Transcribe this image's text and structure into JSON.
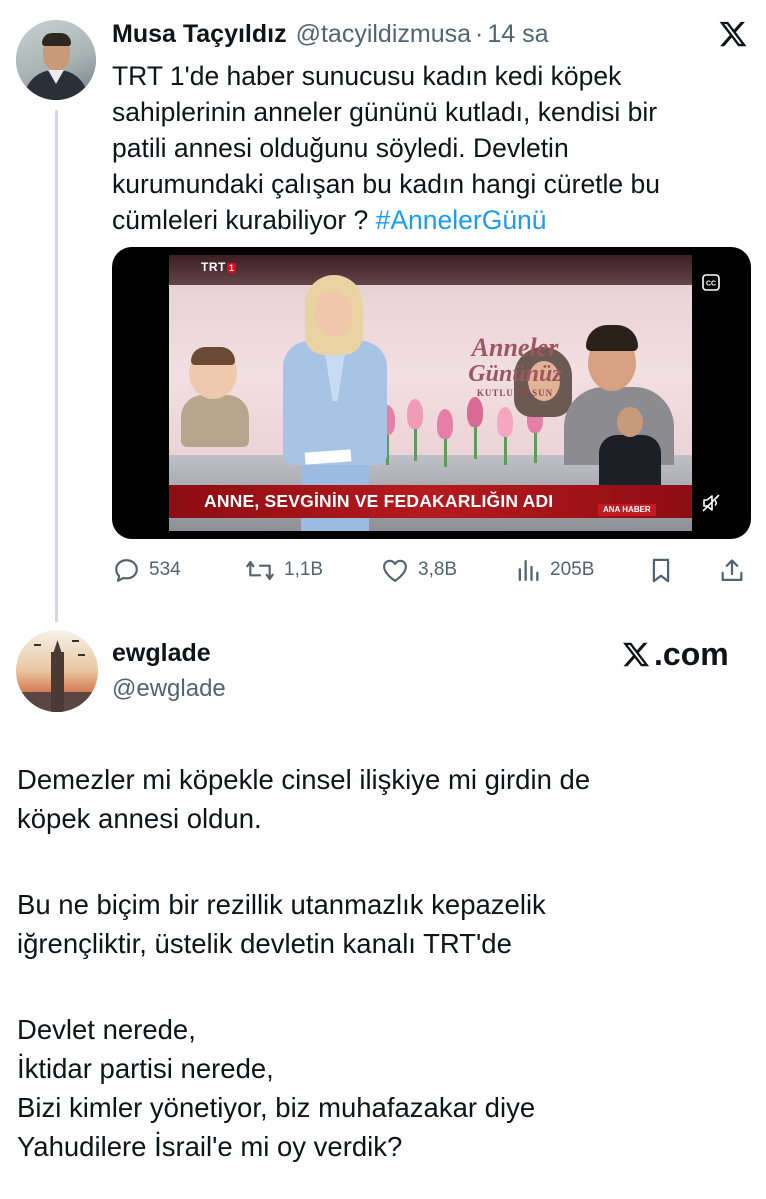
{
  "tweet": {
    "author_name": "Musa Taçyıldız",
    "author_handle": "@tacyildizmusa",
    "separator": "·",
    "time": "14 sa",
    "platform_icon": "x-logo-icon",
    "text_lines": [
      "TRT 1'de haber sunucusu kadın kedi köpek",
      "sahiplerinin anneler gününü kutladı, kendisi bir",
      "patili annesi olduğunu söyledi. Devletin",
      "kurumundaki  çalışan bu kadın hangi cüretle bu",
      "cümleleri kurabiliyor ? "
    ],
    "hashtag": "#AnnelerGünü",
    "hashtag_color": "#1d9bf0",
    "media": {
      "channel_logo": "TRT",
      "channel_number": "1",
      "banner_line1": "Anneler",
      "banner_line2": "Gününüz",
      "banner_line3": "KUTLU OLSUN",
      "lower_third": "ANNE, SEVGİNİN VE FEDAKARLIĞIN ADI",
      "program_tag": "ANA HABER",
      "captions_icon": "closed-captions-icon",
      "mute_icon": "volume-muted-icon"
    },
    "actions": {
      "replies": "534",
      "retweets": "1,1B",
      "likes": "3,8B",
      "views": "205B",
      "bookmark_icon": "bookmark-icon",
      "share_icon": "share-icon"
    }
  },
  "quoted": {
    "author_name": "ewglade",
    "author_handle": "@ewglade",
    "source_label": ".com",
    "body_paragraphs": [
      [
        "Demezler mi köpekle cinsel ilişkiye mi girdin de",
        "köpek annesi oldun."
      ],
      [
        "Bu ne biçim bir rezillik utanmazlık kepazelik",
        "iğrençliktir, üstelik devletin kanalı TRT'de"
      ],
      [
        "Devlet nerede,",
        "İktidar partisi nerede,",
        "Bizi kimler yönetiyor, biz muhafazakar diye",
        "Yahudilere İsrail'e mi oy verdik?"
      ]
    ]
  },
  "colors": {
    "text_primary": "#0f1419",
    "text_secondary": "#536471",
    "thread_line": "#cfd9de",
    "lower_third_red": "#b61a20"
  }
}
